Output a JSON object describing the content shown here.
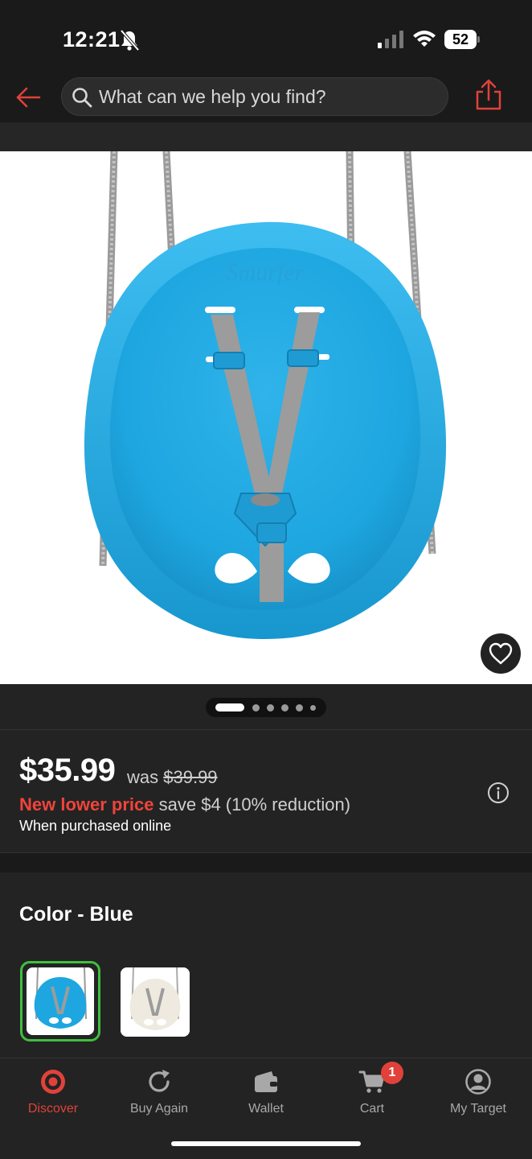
{
  "status_bar": {
    "time": "12:21",
    "battery": "52",
    "icons": [
      "bell-slash-icon",
      "signal-icon",
      "wifi-icon",
      "battery-icon"
    ]
  },
  "top_nav": {
    "back_icon": "back-arrow-icon",
    "search_placeholder": "What can we help you find?",
    "share_icon": "share-icon"
  },
  "product": {
    "image": "blue-toddler-swing-seat",
    "favorite_icon": "heart-icon",
    "carousel": {
      "total": 6,
      "active_index": 0
    }
  },
  "price": {
    "current": "$35.99",
    "was_label": "was",
    "was_value": "$39.99",
    "new_lower_label": "New lower price",
    "save_text": "save $4 (10% reduction)",
    "note": "When purchased online",
    "info_icon": "info-icon"
  },
  "color": {
    "heading": "Color - Blue",
    "options": [
      {
        "name": "Blue",
        "selected": true
      },
      {
        "name": "Cream",
        "selected": false
      }
    ]
  },
  "tab_bar": {
    "tabs": [
      {
        "label": "Discover",
        "icon": "target-logo-icon",
        "active": true
      },
      {
        "label": "Buy Again",
        "icon": "refresh-icon",
        "active": false
      },
      {
        "label": "Wallet",
        "icon": "wallet-icon",
        "active": false
      },
      {
        "label": "Cart",
        "icon": "cart-icon",
        "active": false
      },
      {
        "label": "My Target",
        "icon": "account-icon",
        "active": false
      }
    ],
    "cart_badge": "1"
  },
  "colors": {
    "accent_red": "#e0423a",
    "selected_green": "#3fbf3f",
    "background": "#1a1a1a"
  }
}
